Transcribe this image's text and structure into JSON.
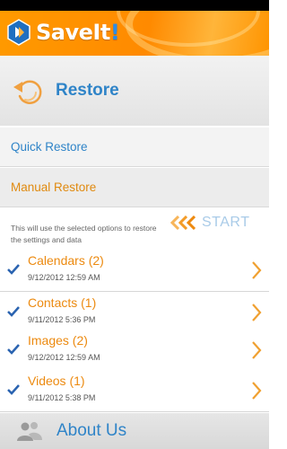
{
  "app": {
    "name_main": "SaveIt",
    "name_suffix": "!"
  },
  "restore_header": {
    "title": "Restore",
    "icon": "restore-arrow-icon"
  },
  "options": {
    "quick_restore": "Quick Restore",
    "manual_restore": "Manual Restore"
  },
  "info": {
    "text": "This will use the selected options to restore the settings and data"
  },
  "start": {
    "label": "START",
    "icon": "triple-chevron-icon"
  },
  "items": [
    {
      "title": "Calendars (2)",
      "date": "9/12/2012 12:59 AM",
      "checked": true
    },
    {
      "title": "Contacts (1)",
      "date": "9/11/2012 5:36 PM",
      "checked": true
    },
    {
      "title": "Images (2)",
      "date": "9/12/2012 12:59 AM",
      "checked": true
    },
    {
      "title": "Videos (1)",
      "date": "9/11/2012 5:38 PM",
      "checked": true
    }
  ],
  "about": {
    "label": "About Us",
    "icon": "people-icon"
  },
  "colors": {
    "accent_blue": "#2f84c8",
    "accent_orange": "#ec8a10",
    "header_orange": "#ff8a00"
  }
}
